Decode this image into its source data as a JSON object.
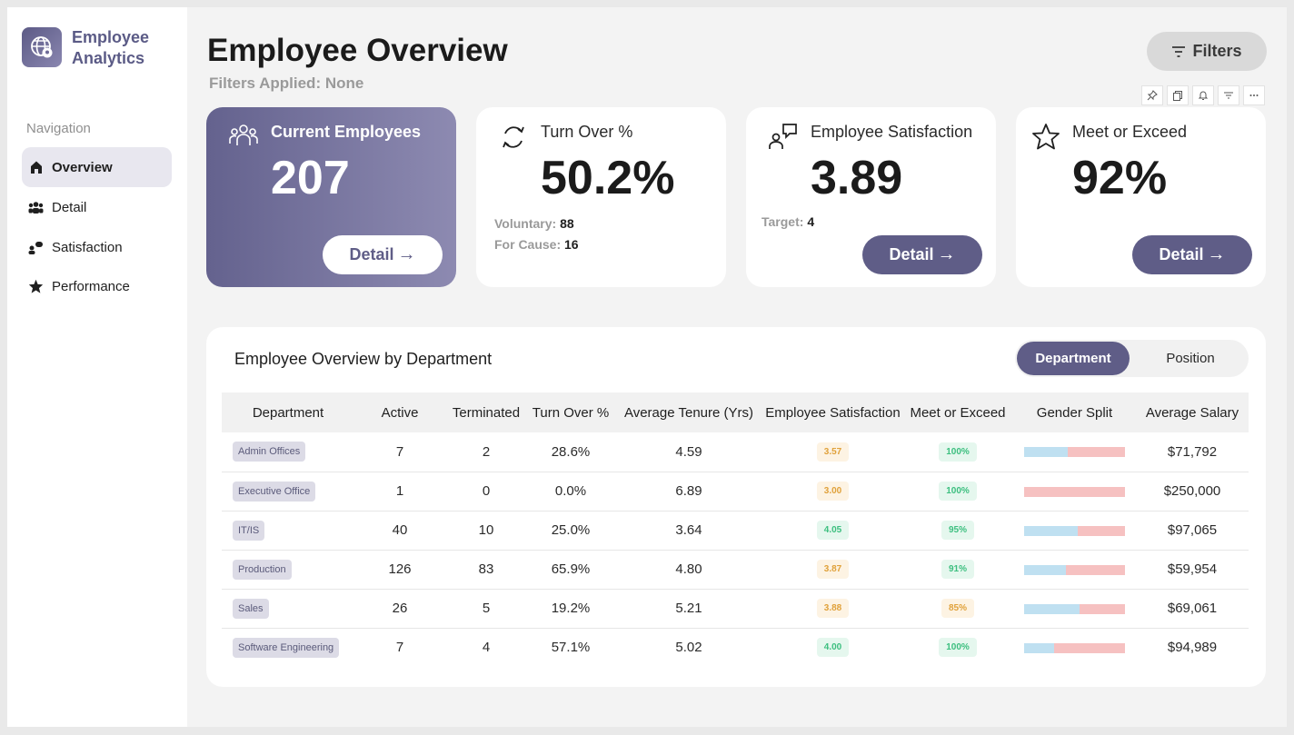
{
  "app": {
    "title_line1": "Employee",
    "title_line2": "Analytics"
  },
  "nav": {
    "heading": "Navigation",
    "items": [
      {
        "label": "Overview",
        "icon": "home-icon",
        "active": true
      },
      {
        "label": "Detail",
        "icon": "people-icon",
        "active": false
      },
      {
        "label": "Satisfaction",
        "icon": "chat-people-icon",
        "active": false
      },
      {
        "label": "Performance",
        "icon": "star-icon",
        "active": false
      }
    ]
  },
  "header": {
    "title": "Employee Overview",
    "filters_applied": "Filters Applied: None",
    "filters_button": "Filters"
  },
  "kpis": [
    {
      "label": "Current Employees",
      "value": "207",
      "button": "Detail",
      "icon": "people-group-icon"
    },
    {
      "label": "Turn Over %",
      "value": "50.2%",
      "icon": "refresh-icon",
      "sub": [
        {
          "label": "Voluntary:",
          "value": "88"
        },
        {
          "label": "For Cause:",
          "value": "16"
        }
      ]
    },
    {
      "label": "Employee Satisfaction",
      "value": "3.89",
      "button": "Detail",
      "icon": "chat-person-icon",
      "sub": [
        {
          "label": "Target:",
          "value": "4"
        }
      ]
    },
    {
      "label": "Meet or Exceed",
      "value": "92%",
      "button": "Detail",
      "icon": "star-outline-icon"
    }
  ],
  "table_panel": {
    "title": "Employee Overview by Department",
    "toggle": {
      "active": "Department",
      "inactive": "Position"
    },
    "columns": [
      "Department",
      "Active",
      "Terminated",
      "Turn Over %",
      "Average Tenure (Yrs)",
      "Employee Satisfaction",
      "Meet or Exceed",
      "Gender Split",
      "Average Salary"
    ],
    "rows": [
      {
        "department": "Admin Offices",
        "active": "7",
        "terminated": "2",
        "turnover": "28.6%",
        "tenure": "4.59",
        "satisfaction": "3.57",
        "sat_status": "amber",
        "meet": "100%",
        "meet_status": "green",
        "male_share": 0.43,
        "salary": "$71,792"
      },
      {
        "department": "Executive Office",
        "active": "1",
        "terminated": "0",
        "turnover": "0.0%",
        "tenure": "6.89",
        "satisfaction": "3.00",
        "sat_status": "amber",
        "meet": "100%",
        "meet_status": "green",
        "male_share": 0.0,
        "salary": "$250,000"
      },
      {
        "department": "IT/IS",
        "active": "40",
        "terminated": "10",
        "turnover": "25.0%",
        "tenure": "3.64",
        "satisfaction": "4.05",
        "sat_status": "green",
        "meet": "95%",
        "meet_status": "green",
        "male_share": 0.53,
        "salary": "$97,065"
      },
      {
        "department": "Production",
        "active": "126",
        "terminated": "83",
        "turnover": "65.9%",
        "tenure": "4.80",
        "satisfaction": "3.87",
        "sat_status": "amber",
        "meet": "91%",
        "meet_status": "green",
        "male_share": 0.41,
        "salary": "$59,954"
      },
      {
        "department": "Sales",
        "active": "26",
        "terminated": "5",
        "turnover": "19.2%",
        "tenure": "5.21",
        "satisfaction": "3.88",
        "sat_status": "amber",
        "meet": "85%",
        "meet_status": "amber",
        "male_share": 0.55,
        "salary": "$69,061"
      },
      {
        "department": "Software Engineering",
        "active": "7",
        "terminated": "4",
        "turnover": "57.1%",
        "tenure": "5.02",
        "satisfaction": "4.00",
        "sat_status": "green",
        "meet": "100%",
        "meet_status": "green",
        "male_share": 0.3,
        "salary": "$94,989"
      }
    ]
  },
  "colors": {
    "accent": "#5f5d87",
    "male": "#bfe0f1",
    "female": "#f6c1c1",
    "amber": "#e0a13a",
    "green": "#3cbf7f"
  }
}
